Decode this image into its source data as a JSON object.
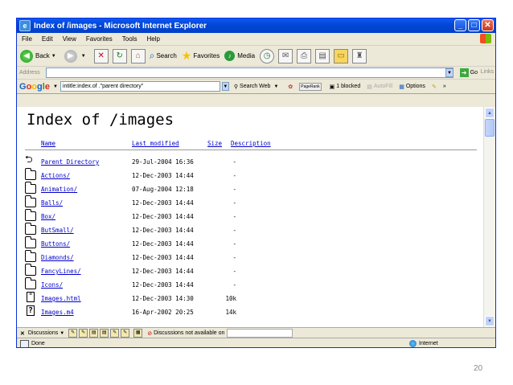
{
  "window": {
    "title": "Index of /images - Microsoft Internet Explorer"
  },
  "menu": [
    "File",
    "Edit",
    "View",
    "Favorites",
    "Tools",
    "Help"
  ],
  "toolbar": {
    "back": "Back",
    "search": "Search",
    "favorites": "Favorites",
    "media": "Media"
  },
  "address": {
    "label": "Address",
    "go": "Go",
    "links": "Links"
  },
  "google": {
    "query": "intitle:index.of .\"parent directory\"",
    "search_web": "Search Web",
    "pagerank": "PageRank",
    "blocked": "1 blocked",
    "autofill": "AutoFill",
    "options": "Options"
  },
  "page": {
    "heading": "Index of /images",
    "columns": {
      "name": "Name",
      "modified": "Last modified",
      "size": "Size",
      "description": "Description"
    },
    "rows": [
      {
        "icon": "back",
        "name": "Parent Directory",
        "modified": "29-Jul-2004 16:36",
        "size": "-"
      },
      {
        "icon": "folder",
        "name": "Actions/",
        "modified": "12-Dec-2003 14:44",
        "size": "-"
      },
      {
        "icon": "folder",
        "name": "Animation/",
        "modified": "07-Aug-2004 12:18",
        "size": "-"
      },
      {
        "icon": "folder",
        "name": "Balls/",
        "modified": "12-Dec-2003 14:44",
        "size": "-"
      },
      {
        "icon": "folder",
        "name": "Box/",
        "modified": "12-Dec-2003 14:44",
        "size": "-"
      },
      {
        "icon": "folder",
        "name": "ButSmall/",
        "modified": "12-Dec-2003 14:44",
        "size": "-"
      },
      {
        "icon": "folder",
        "name": "Buttons/",
        "modified": "12-Dec-2003 14:44",
        "size": "-"
      },
      {
        "icon": "folder",
        "name": "Diamonds/",
        "modified": "12-Dec-2003 14:44",
        "size": "-"
      },
      {
        "icon": "folder",
        "name": "FancyLines/",
        "modified": "12-Dec-2003 14:44",
        "size": "-"
      },
      {
        "icon": "folder",
        "name": "Icons/",
        "modified": "12-Dec-2003 14:44",
        "size": "-"
      },
      {
        "icon": "doc",
        "name": "Images.html",
        "modified": "12-Dec-2003 14:30",
        "size": "10k"
      },
      {
        "icon": "unknown",
        "name": "Images.m4",
        "modified": "16-Apr-2002 20:25",
        "size": "14k"
      }
    ]
  },
  "discussions": {
    "label": "Discussions",
    "status": "Discussions not available on"
  },
  "status": {
    "text": "Done",
    "zone": "Internet"
  },
  "slide": {
    "page_number": "20"
  }
}
